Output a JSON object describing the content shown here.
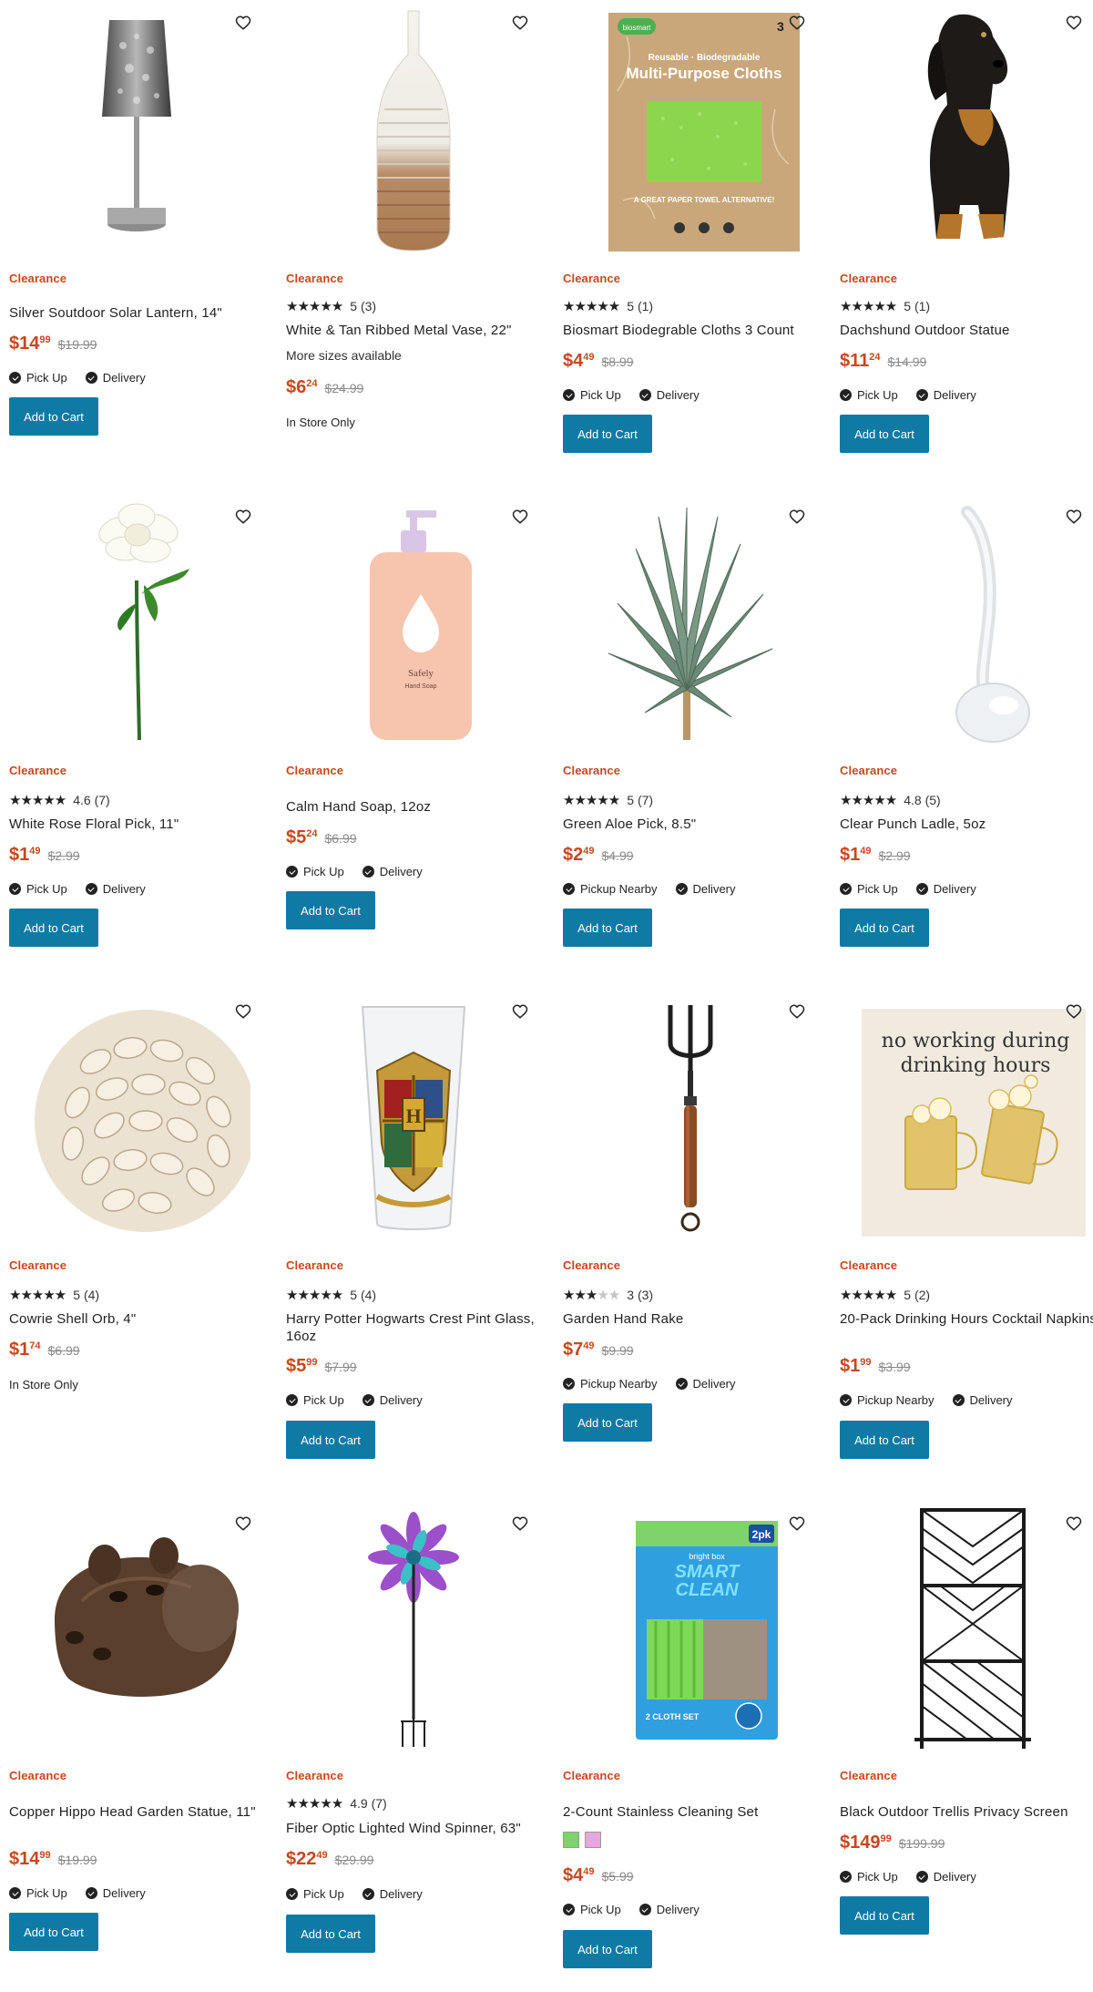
{
  "ui": {
    "add_to_cart": "Add to Cart",
    "clearance": "Clearance",
    "pick_up": "Pick Up",
    "pickup_nearby": "Pickup Nearby",
    "delivery": "Delivery",
    "in_store_only": "In Store Only",
    "more_sizes": "More sizes available"
  },
  "products": [
    {
      "title": "Silver Soutdoor Solar Lantern, 14\"",
      "price_dollars": "$14",
      "price_cents": "99",
      "was": "$19.99"
    },
    {
      "title": "White & Tan Ribbed Metal Vase, 22\"",
      "rating": "5",
      "reviews": "(3)",
      "price_dollars": "$6",
      "price_cents": "24",
      "was": "$24.99"
    },
    {
      "title": "Biosmart Biodegrable Cloths 3 Count",
      "rating": "5",
      "reviews": "(1)",
      "price_dollars": "$4",
      "price_cents": "49",
      "was": "$8.99"
    },
    {
      "title": "Dachshund Outdoor Statue",
      "rating": "5",
      "reviews": "(1)",
      "price_dollars": "$11",
      "price_cents": "24",
      "was": "$14.99"
    },
    {
      "title": "White Rose Floral Pick, 11\"",
      "rating": "4.6",
      "reviews": "(7)",
      "price_dollars": "$1",
      "price_cents": "49",
      "was": "$2.99"
    },
    {
      "title": "Calm Hand Soap, 12oz",
      "price_dollars": "$5",
      "price_cents": "24",
      "was": "$6.99"
    },
    {
      "title": "Green Aloe Pick, 8.5\"",
      "rating": "5",
      "reviews": "(7)",
      "price_dollars": "$2",
      "price_cents": "49",
      "was": "$4.99"
    },
    {
      "title": "Clear Punch Ladle, 5oz",
      "rating": "4.8",
      "reviews": "(5)",
      "price_dollars": "$1",
      "price_cents": "49",
      "was": "$2.99"
    },
    {
      "title": "Cowrie Shell Orb, 4\"",
      "rating": "5",
      "reviews": "(4)",
      "price_dollars": "$1",
      "price_cents": "74",
      "was": "$6.99"
    },
    {
      "title": "Harry Potter Hogwarts Crest Pint Glass, 16oz",
      "rating": "5",
      "reviews": "(4)",
      "price_dollars": "$5",
      "price_cents": "99",
      "was": "$7.99"
    },
    {
      "title": "Garden Hand Rake",
      "rating": "3",
      "reviews": "(3)",
      "price_dollars": "$7",
      "price_cents": "49",
      "was": "$9.99"
    },
    {
      "title": "20-Pack Drinking Hours Cocktail Napkins",
      "rating": "5",
      "reviews": "(2)",
      "price_dollars": "$1",
      "price_cents": "99",
      "was": "$3.99"
    },
    {
      "title": "Copper Hippo Head Garden Statue, 11\"",
      "price_dollars": "$14",
      "price_cents": "99",
      "was": "$19.99"
    },
    {
      "title": "Fiber Optic Lighted Wind Spinner, 63\"",
      "rating": "4.9",
      "reviews": "(7)",
      "price_dollars": "$22",
      "price_cents": "49",
      "was": "$29.99"
    },
    {
      "title": "2-Count Stainless Cleaning Set",
      "price_dollars": "$4",
      "price_cents": "49",
      "was": "$5.99"
    },
    {
      "title": "Black Outdoor Trellis Privacy Screen",
      "price_dollars": "$149",
      "price_cents": "99",
      "was": "$199.99"
    }
  ],
  "image_text": {
    "cloth_brand": "biosmart",
    "cloth_count": "3",
    "cloth_line1": "Reusable · Biodegradable",
    "cloth_line2": "Multi-Purpose Cloths",
    "cloth_line3": "A GREAT PAPER TOWEL ALTERNATIVE!",
    "soap_brand": "Safely",
    "soap_name": "Hand Soap",
    "napkin_line1": "no working during",
    "napkin_line2": "drinking hours",
    "clean_brand": "bright box",
    "clean_title1": "SMART",
    "clean_title2": "CLEAN",
    "clean_pack": "2pk",
    "clean_set": "2 CLOTH SET"
  },
  "colors": {
    "accent": "#c8471e",
    "button": "#0f7aa3",
    "swatch1": "#7fd36b",
    "swatch2": "#e6a6df"
  }
}
